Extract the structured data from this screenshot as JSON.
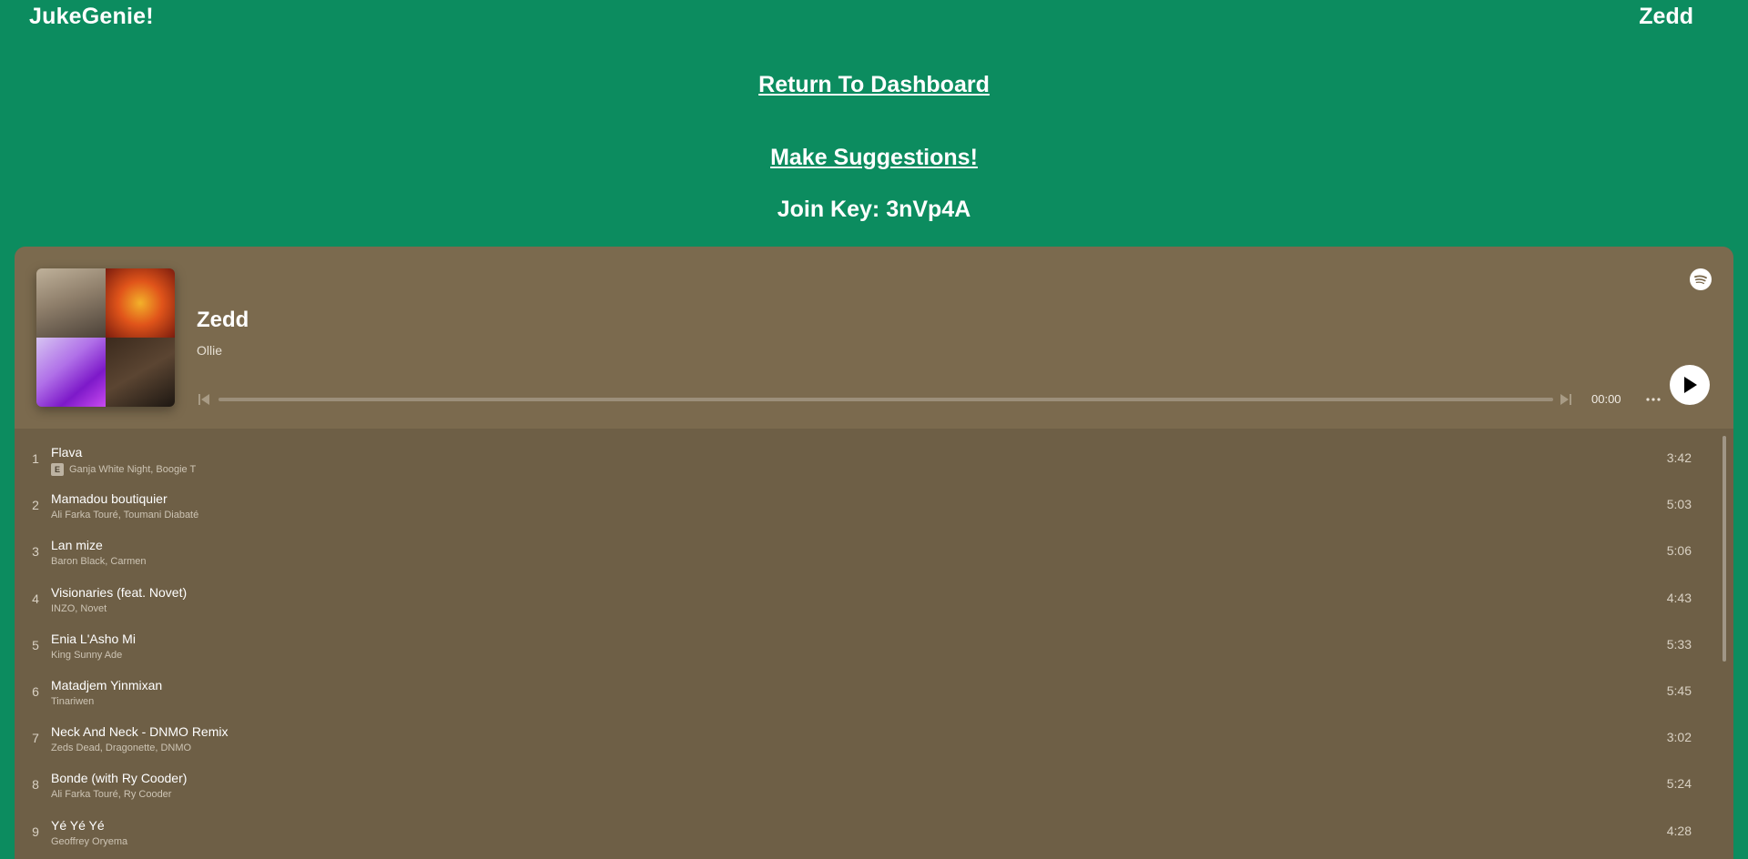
{
  "header": {
    "brand": "JukeGenie!",
    "user": "Zedd"
  },
  "links": {
    "dashboard": "Return To Dashboard",
    "suggestions": "Make Suggestions!",
    "join_key": "Join Key: 3nVp4A"
  },
  "player": {
    "playlist_title": "Zedd",
    "owner": "Ollie",
    "time": "00:00",
    "progress": 0,
    "colors": {
      "page_bg": "#0c8c5f",
      "player_bg": "#6e5f46",
      "header_bg": "#7b6a4e"
    },
    "icons": [
      "spotify-icon",
      "skip-previous-icon",
      "skip-next-icon",
      "more-options-icon",
      "play-icon"
    ]
  },
  "tracks": [
    {
      "num": "1",
      "name": "Flava",
      "artists": "Ganja White Night, Boogie T",
      "explicit": "E",
      "duration": "3:42"
    },
    {
      "num": "2",
      "name": "Mamadou boutiquier",
      "artists": "Ali Farka Touré, Toumani Diabaté",
      "explicit": "",
      "duration": "5:03"
    },
    {
      "num": "3",
      "name": "Lan mize",
      "artists": "Baron Black, Carmen",
      "explicit": "",
      "duration": "5:06"
    },
    {
      "num": "4",
      "name": "Visionaries (feat. Novet)",
      "artists": "INZO, Novet",
      "explicit": "",
      "duration": "4:43"
    },
    {
      "num": "5",
      "name": "Enia L'Asho Mi",
      "artists": "King Sunny Ade",
      "explicit": "",
      "duration": "5:33"
    },
    {
      "num": "6",
      "name": "Matadjem Yinmixan",
      "artists": "Tinariwen",
      "explicit": "",
      "duration": "5:45"
    },
    {
      "num": "7",
      "name": "Neck And Neck - DNMO Remix",
      "artists": "Zeds Dead, Dragonette, DNMO",
      "explicit": "",
      "duration": "3:02"
    },
    {
      "num": "8",
      "name": "Bonde (with Ry Cooder)",
      "artists": "Ali Farka Touré, Ry Cooder",
      "explicit": "",
      "duration": "5:24"
    },
    {
      "num": "9",
      "name": "Yé Yé Yé",
      "artists": "Geoffrey Oryema",
      "explicit": "",
      "duration": "4:28"
    }
  ]
}
